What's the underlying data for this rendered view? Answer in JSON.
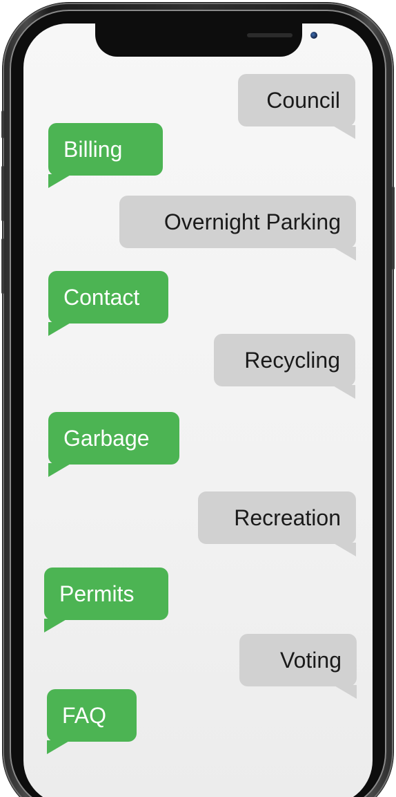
{
  "messages": [
    {
      "label": "Council",
      "side": "right"
    },
    {
      "label": "Billing",
      "side": "left"
    },
    {
      "label": "Overnight Parking",
      "side": "right"
    },
    {
      "label": "Contact",
      "side": "left"
    },
    {
      "label": "Recycling",
      "side": "right"
    },
    {
      "label": "Garbage",
      "side": "left"
    },
    {
      "label": "Recreation",
      "side": "right"
    },
    {
      "label": "Permits",
      "side": "left"
    },
    {
      "label": "Voting",
      "side": "right"
    },
    {
      "label": "FAQ",
      "side": "left"
    }
  ],
  "colors": {
    "left_bubble": "#4cb453",
    "right_bubble": "#d1d1d1",
    "phone_body": "#1d1d1d",
    "screen": "#f2f2f2"
  }
}
